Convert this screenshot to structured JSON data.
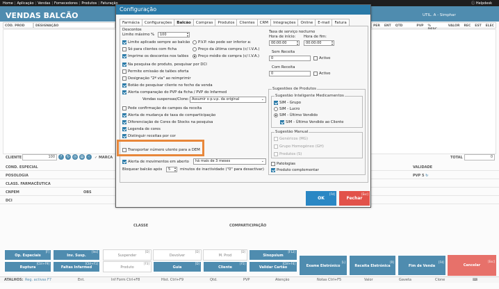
{
  "topbar": {
    "items": [
      "Home",
      "Aplicação",
      "Vendas",
      "Fornecedores",
      "Produtos",
      "Faturação"
    ],
    "right": "Helpdesk"
  },
  "app": {
    "title": "VENDAS BALCÃO",
    "user": "UTIL. A - Simphar",
    "col_cod": "CÓD. PROD",
    "col_desig": "DESIGNAÇÃO",
    "cols_right": [
      "PER",
      "ENT",
      "QTD",
      "PVP",
      "% DESC",
      "VALOR",
      "REC",
      "EST",
      "ELEC"
    ],
    "cliente_label": "CLIENTE",
    "cliente_value": "100",
    "marca_label": "MARCA",
    "total_label": "TOTAL",
    "total_value": "0",
    "cond_especial": "COND. ESPECIAL",
    "posologia": "POSOLOGIA",
    "classe": "CLASS. FARMACÊUTICA",
    "cnpem": "CNPEM",
    "obs": "OBS",
    "dci": "DCI",
    "classe2": "CLASSE",
    "comparticipacao": "COMPARTICIPAÇÃO",
    "validade": "VALIDADE",
    "pvp5": "PVP 5"
  },
  "bottom_buttons": [
    {
      "label": "Op. Especiais",
      "key": "[F]",
      "style": "blue"
    },
    {
      "label": "Inv. Susp.",
      "key": "[Ins]",
      "style": "blue"
    },
    {
      "label": "Suspender",
      "key": "[D]",
      "style": "grey"
    },
    {
      "label": "Devolver",
      "key": "[D]",
      "style": "grey"
    },
    {
      "label": "M. Prod",
      "key": "[D]",
      "style": "grey"
    },
    {
      "label": "Sinopsium",
      "key": "[F12]",
      "style": "blue"
    },
    {
      "label": "Exame Eletrónico",
      "key": "[L]",
      "style": "blue"
    },
    {
      "label": "Receita Eletrónica",
      "key": "[R]",
      "style": "blue"
    },
    {
      "label": "Fim de Venda",
      "key": "[F4]",
      "style": "blue"
    },
    {
      "label": "Cancelar",
      "key": "[Esc]",
      "style": "red"
    },
    {
      "label": "Ruptura",
      "key": "[Ctrl+F9]",
      "style": "blue"
    },
    {
      "label": "Faltas Infarmed",
      "key": "[Ctrl+F1]",
      "style": "blue"
    },
    {
      "label": "Produto",
      "key": "[F3]",
      "style": "grey"
    },
    {
      "label": "Guia",
      "key": "[D]",
      "style": "blue"
    },
    {
      "label": "Cliente",
      "key": "[F5]",
      "style": "blue"
    },
    {
      "label": "Validar Cartão",
      "key": "[Ctrl+F4]",
      "style": "blue"
    }
  ],
  "statusbar": {
    "atalhos": "ATALHOS:",
    "reg": "Reg. activas F7",
    "items": [
      "Ent.",
      "Inf Form Ctrl+F8",
      "Hist. Ctrl+F9",
      "Qtd.",
      "PVP",
      "Atenção",
      "Notas Ctrl+F5",
      "Valor",
      "Gaveta",
      "Clone"
    ]
  },
  "dialog": {
    "title": "Configuração",
    "tabs": [
      "Farmácia",
      "Configurações",
      "Balcão",
      "Compras",
      "Produtos",
      "Clientes",
      "CRM",
      "Integrações",
      "Online",
      "E-mail",
      "Fatura"
    ],
    "active_tab": "Balcão",
    "descontos": {
      "title": "Descontos",
      "limite_label": "Limite máximo %",
      "limite_value": "100"
    },
    "options_left": [
      {
        "label": "Limite aplicado sempre ao balcão",
        "checked": true
      },
      {
        "label": "Só para clientes com ficha",
        "checked": false
      },
      {
        "label": "Imprime os descontos nos talões",
        "checked": true
      }
    ],
    "radio_pvp": [
      {
        "label": "P.V.P. não pode ser inferior a:",
        "checked": false
      },
      {
        "label": "Preço da última compra (c/ I.V.A.)",
        "checked": false
      },
      {
        "label": "Preço médio de compra (c/ I.V.A.)",
        "checked": true
      }
    ],
    "options_main": [
      {
        "label": "Na pesquisa de produto, pesquisar por DCI",
        "checked": true
      },
      {
        "label": "Permite emissão de talões oferta",
        "checked": false
      },
      {
        "label": "Designação \"2ª via\" ao reimprimir",
        "checked": false
      },
      {
        "label": "Botão de pesquisar cliente no fecho da venda",
        "checked": true
      },
      {
        "label": "Alerta comparação do PVP da ficha / PVP do Infarmed",
        "checked": true
      }
    ],
    "vendas_suspensas_label": "Vendas suspensas/Clone:",
    "vendas_suspensas_value": "Assumir o p.v.p. da original",
    "options_main2": [
      {
        "label": "Pede confirmação de campos da receita",
        "checked": false
      },
      {
        "label": "Alerta de mudança de taxa de comparticipação",
        "checked": true
      },
      {
        "label": "Diferenciação de Cores de Stocks na pesquisa",
        "checked": true
      },
      {
        "label": "Legenda de cores",
        "checked": true
      },
      {
        "label": "Distinguir receitas por cor",
        "checked": true
      },
      {
        "label": "Transportar número utente para a DEM",
        "checked": false
      }
    ],
    "alerta_label": "Alerta de movimentos em aberto",
    "alerta_checked": true,
    "alerta_value": "há mais de 3 meses",
    "bloquear_label": "Bloquear balcão após",
    "bloquear_value": "5",
    "bloquear_suffix": "minutos de inactividade (\"0\" para desactivar)",
    "taxa": {
      "title": "Taxa de serviço nocturno",
      "hora_inicio_label": "Hora de início:",
      "hora_fim_label": "Hora de fim:",
      "hora_inicio": "00:00:00",
      "hora_fim": "00:00:00",
      "sem_receita_label": "Sem Receita",
      "sem_receita_value": "0",
      "com_receita_label": "Com Receita",
      "com_receita_value": "0",
      "activo_label": "Activo"
    },
    "sugestoes": {
      "title": "Sugestões de Produtos",
      "inteligente_title": "Sugestão Inteligente Medicamentos",
      "inteligente_options": [
        {
          "label": "SIM - Grupo",
          "checked": true,
          "type": "checkbox"
        },
        {
          "label": "SIM - Lucro",
          "checked": false,
          "type": "radio"
        },
        {
          "label": "SIM - Último Vendido",
          "checked": true,
          "type": "radio"
        },
        {
          "label": "SIM - Último Vendido ao Cliente",
          "checked": true,
          "type": "checkbox"
        }
      ],
      "manual_title": "Sugestão Manual",
      "manual_options": [
        "Genéricos (MG)",
        "Grupo Homogéneo (GH)",
        "Produtos (S)"
      ],
      "patologias": "Patologias",
      "patologias_checked": false,
      "produto_complementar": "Produto complementar",
      "produto_complementar_checked": true
    },
    "ok_label": "OK",
    "ok_key": "[F4]",
    "fechar_label": "Fechar",
    "fechar_key": "[Esc]",
    "colors": {
      "title_bar": "#2a7aa8",
      "ok": "#2a87c4",
      "fechar": "#e2524a",
      "highlight": "#e8873a"
    }
  }
}
